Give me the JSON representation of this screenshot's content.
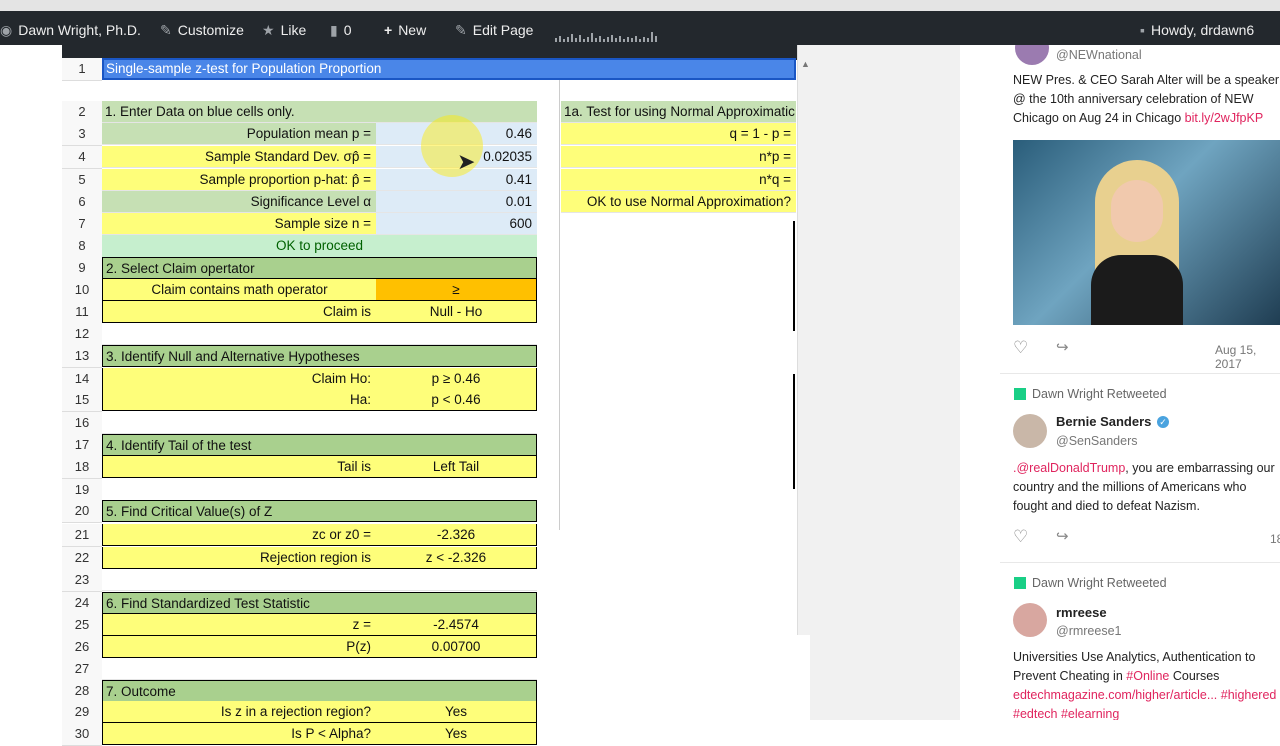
{
  "adminbar": {
    "site": "Dawn Wright, Ph.D.",
    "customize": "Customize",
    "like": "Like",
    "comments": "0",
    "new": "New",
    "edit_page": "Edit Page",
    "howdy": "Howdy, drdawn6"
  },
  "sheet": {
    "title": "Single-sample z-test for Population Proportion",
    "rows": [
      {
        "n": "1"
      },
      {
        "n": "2",
        "b": "1. Enter Data on blue cells only.",
        "d": "1a. Test for using Normal Approximatic"
      },
      {
        "n": "3",
        "b": "Population mean p =",
        "c": "0.46",
        "d": "q = 1 - p ="
      },
      {
        "n": "4",
        "b": "Sample Standard Dev. σp̂ =",
        "c": "0.02035",
        "d": "n*p ="
      },
      {
        "n": "5",
        "b": "Sample proportion p-hat:  p̂ =",
        "c": "0.41",
        "d": "n*q ="
      },
      {
        "n": "6",
        "b": "Significance Level α",
        "c": "0.01",
        "d": "OK to use Normal Approximation?"
      },
      {
        "n": "7",
        "b": "Sample size n =",
        "c": "600"
      },
      {
        "n": "8",
        "b": "OK to proceed"
      },
      {
        "n": "9",
        "b": "2. Select Claim opertator"
      },
      {
        "n": "10",
        "b": "Claim contains math operator",
        "c": "≥"
      },
      {
        "n": "11",
        "b": "Claim is",
        "c": "Null - Ho"
      },
      {
        "n": "12"
      },
      {
        "n": "13",
        "b": "3. Identify Null and Alternative Hypotheses"
      },
      {
        "n": "14",
        "b": "Claim Ho:",
        "c": "p  ≥ 0.46"
      },
      {
        "n": "15",
        "b": "Ha:",
        "c": "p < 0.46"
      },
      {
        "n": "16"
      },
      {
        "n": "17",
        "b": "4. Identify Tail of the test"
      },
      {
        "n": "18",
        "b": "Tail is",
        "c": "Left Tail"
      },
      {
        "n": "19"
      },
      {
        "n": "20",
        "b": "5. Find Critical Value(s) of Z"
      },
      {
        "n": "21",
        "b": "zc or z0 =",
        "c": "-2.326"
      },
      {
        "n": "22",
        "b": "Rejection region is",
        "c": "z < -2.326"
      },
      {
        "n": "23"
      },
      {
        "n": "24",
        "b": "6. Find Standardized Test Statistic"
      },
      {
        "n": "25",
        "b": "z =",
        "c": "-2.4574"
      },
      {
        "n": "26",
        "b": "P(z)",
        "c": "0.00700"
      },
      {
        "n": "27"
      },
      {
        "n": "28",
        "b": "7. Outcome"
      },
      {
        "n": "29",
        "b": "Is z in a rejection region?",
        "c": "Yes"
      },
      {
        "n": "30",
        "b": "Is P < Alpha?",
        "c": "Yes"
      }
    ]
  },
  "twitter": {
    "t1_handle": "@NEWnational",
    "t1_text": "NEW Pres. & CEO Sarah Alter will be a speaker @ the 10th anniversary celebration of NEW Chicago on Aug 24 in Chicago",
    "t1_link": "bit.ly/2wJfpKP",
    "t1_date": "Aug 15, 2017",
    "rt_label": "Dawn Wright Retweeted",
    "t2_name": "Bernie Sanders",
    "t2_handle": "@SenSanders",
    "t2_mention": ".@realDonaldTrump",
    "t2_text": ", you are embarrassing our country and the millions of Americans who fought and died to defeat Nazism.",
    "t2_count": "18",
    "t3_name": "rmreese",
    "t3_handle": "@rmreese1",
    "t3_text_a": "Universities Use Analytics, Authentication to Prevent Cheating in",
    "t3_tag1": "#Online",
    "t3_text_b": "Courses",
    "t3_link": "edtechmagazine.com/higher/article...",
    "t3_tag2": "#highered",
    "t3_tag3": "#edtech #elearning"
  }
}
